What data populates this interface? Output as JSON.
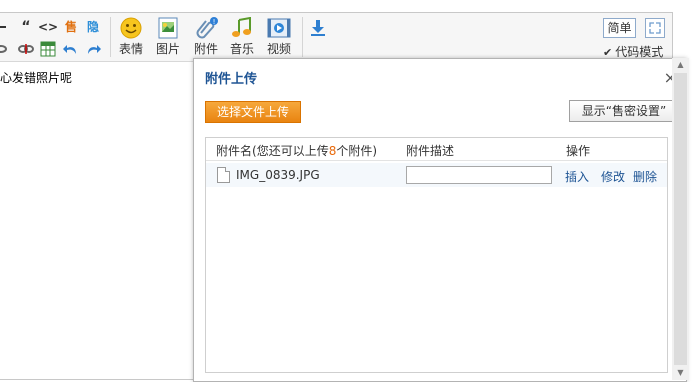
{
  "toolbar": {
    "row1_icons": [
      {
        "name": "hr-icon",
        "glyph": "—"
      },
      {
        "name": "quote-icon",
        "glyph": "“"
      },
      {
        "name": "code-icon",
        "glyph": "<>"
      },
      {
        "name": "sell-icon",
        "glyph": "售"
      },
      {
        "name": "hide-icon",
        "glyph": "隐"
      }
    ],
    "row2_icons": [
      {
        "name": "link-icon",
        "glyph": "∞"
      },
      {
        "name": "unlink-icon",
        "glyph": "⊘"
      },
      {
        "name": "table-icon",
        "glyph": "▦"
      },
      {
        "name": "undo-icon",
        "glyph": "↶"
      },
      {
        "name": "redo-icon",
        "glyph": "↷"
      }
    ],
    "big_buttons": {
      "emoticon": "表情",
      "image": "图片",
      "attachment": "附件",
      "music": "音乐",
      "video": "视频"
    },
    "simple_label": "简单",
    "code_mode_label": "代码模式"
  },
  "editor": {
    "content_text": "心发错照片呢"
  },
  "dialog": {
    "title": "附件上传",
    "close_glyph": "×",
    "select_button": "选择文件上传",
    "setting_button": "显示“售密设置”",
    "table": {
      "col_name": "附件名",
      "hint_prefix": "(您还可以上传",
      "hint_count": "8",
      "hint_suffix": "个附件)",
      "col_desc": "附件描述",
      "col_action": "操作",
      "rows": [
        {
          "filename": "IMG_0839.JPG",
          "description": "",
          "actions": {
            "insert": "插入",
            "edit": "修改",
            "delete": "删除"
          }
        }
      ]
    }
  },
  "colors": {
    "accent_blue": "#1e5494",
    "orange_button": "#e98411",
    "hint_orange": "#e96a0b"
  }
}
